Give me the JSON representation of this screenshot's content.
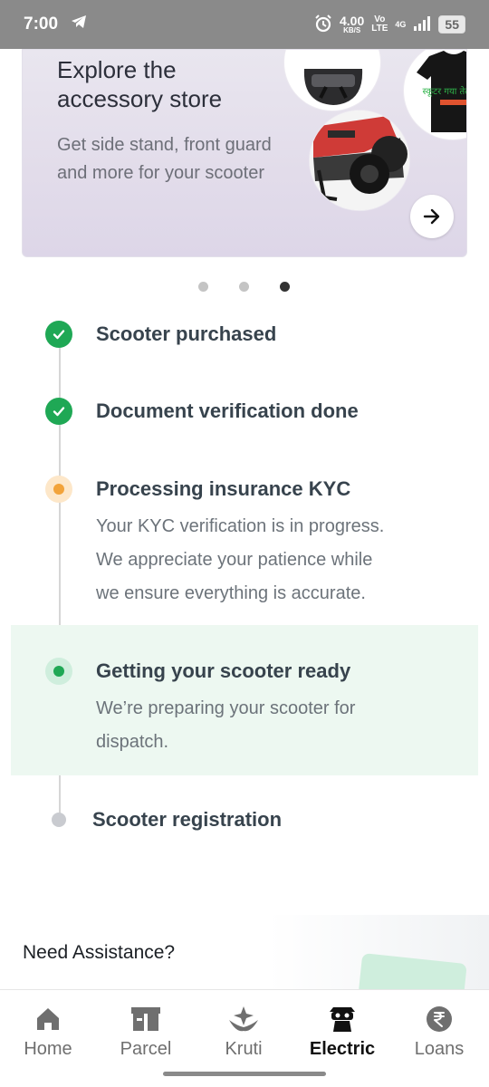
{
  "status_bar": {
    "time": "7:00",
    "net_speed": "4.00",
    "net_unit": "KB/S",
    "volte_top": "Vo",
    "volte_bottom": "LTE",
    "network": "4G",
    "battery": "55"
  },
  "promo": {
    "title": "Explore the accessory store",
    "subtitle": "Get side stand, front guard and more for your scooter",
    "tshirt_text": "स्कूटर गया तेल लेने"
  },
  "pager": {
    "count": 3,
    "active_index": 2
  },
  "timeline": {
    "steps": [
      {
        "title": "Scooter purchased",
        "status": "done"
      },
      {
        "title": "Document verification done",
        "status": "done"
      },
      {
        "title": "Processing insurance KYC",
        "status": "in-progress",
        "description": [
          "Your KYC verification is in progress.",
          "We appreciate your patience while",
          "we ensure everything is accurate."
        ]
      },
      {
        "title": "Getting your scooter ready",
        "status": "active",
        "description": [
          "We’re preparing your scooter for",
          "dispatch."
        ]
      },
      {
        "title": "Scooter registration",
        "status": "upcoming"
      }
    ]
  },
  "assistance": {
    "title": "Need Assistance?"
  },
  "bottom_nav": {
    "items": [
      {
        "label": "Home",
        "icon": "home-icon"
      },
      {
        "label": "Parcel",
        "icon": "parcel-icon"
      },
      {
        "label": "Kruti",
        "icon": "kruti-icon"
      },
      {
        "label": "Electric",
        "icon": "electric-icon",
        "active": true
      },
      {
        "label": "Loans",
        "icon": "rupee-icon"
      }
    ]
  },
  "colors": {
    "done": "#1fa855",
    "in_progress": "#f2a33a",
    "active_bg": "#edf8f1",
    "status_bar": "#8a8a8a"
  }
}
